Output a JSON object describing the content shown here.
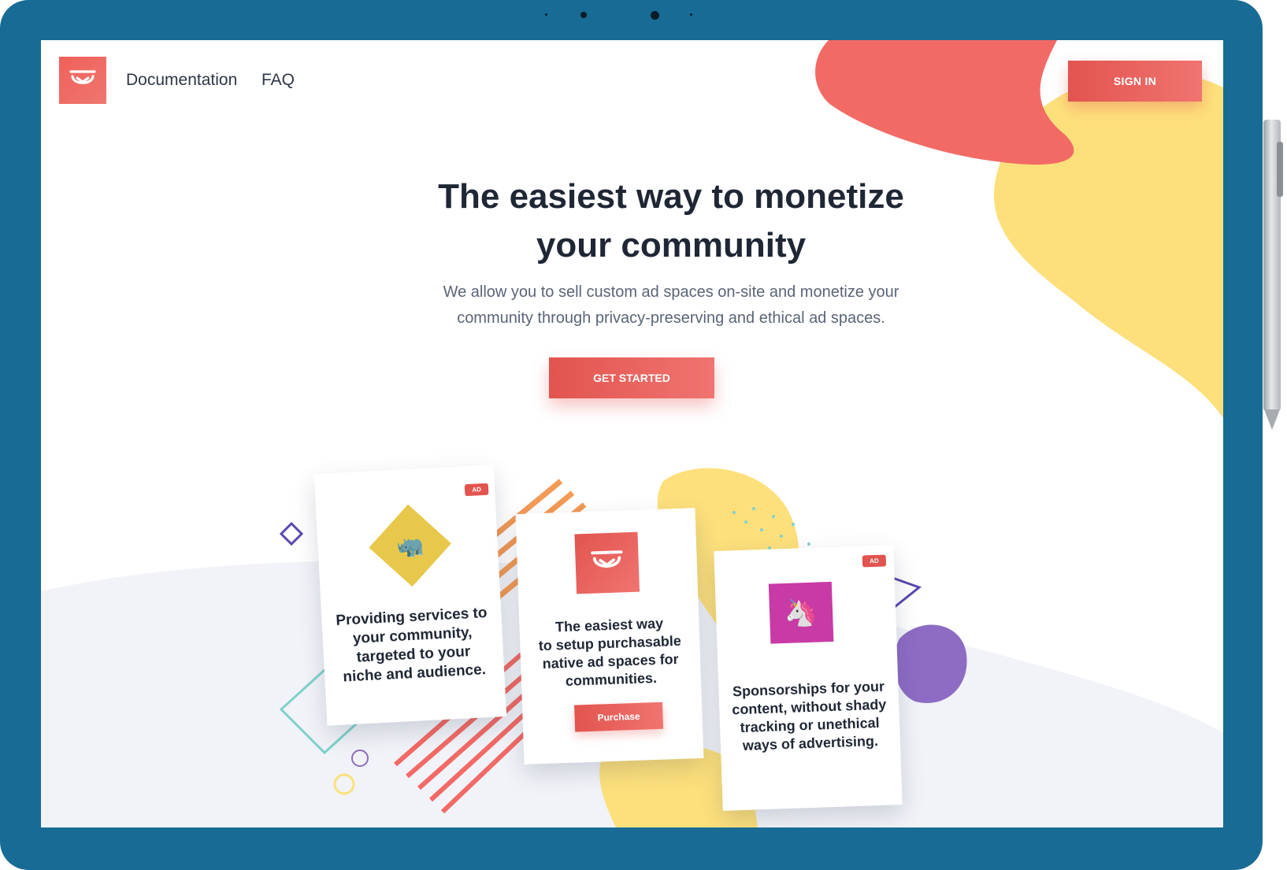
{
  "nav": {
    "documentation": "Documentation",
    "faq": "FAQ",
    "sign_in": "SIGN IN"
  },
  "hero": {
    "title_line1": "The easiest way to monetize",
    "title_line2": "your community",
    "subtitle_line1": "We allow you to sell custom ad spaces on-site and monetize your",
    "subtitle_line2": "community through privacy-preserving and ethical ad spaces.",
    "cta": "GET STARTED"
  },
  "cards": [
    {
      "badge": "AD",
      "image_icon": "rhino-icon",
      "lines": [
        "Providing services to",
        "your community,",
        "targeted to your",
        "niche and audience."
      ]
    },
    {
      "image_icon": "logo-icon",
      "lines": [
        "The easiest way",
        "to setup purchasable",
        "native ad spaces for",
        "communities."
      ],
      "button": "Purchase"
    },
    {
      "badge": "AD",
      "image_icon": "unicorn-icon",
      "lines": [
        "Sponsorships for your",
        "content, without shady",
        "tracking or unethical",
        "ways of advertising."
      ]
    }
  ],
  "colors": {
    "frame": "#186b95",
    "accent": "#e8574f",
    "blob_red": "#f26a66",
    "blob_yellow": "#fde07c",
    "heading": "#1f2735",
    "body_text": "#5a6478"
  }
}
